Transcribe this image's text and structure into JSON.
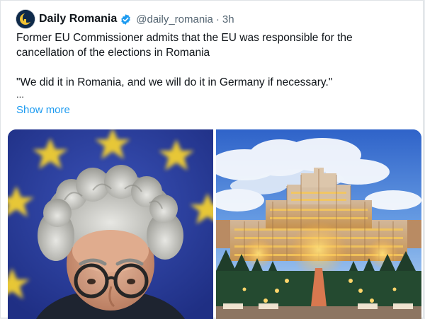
{
  "tweet": {
    "author_name": "Daily Romania",
    "author_handle": "@daily_romania",
    "separator": "·",
    "time_ago": "3h",
    "verified": true,
    "lines": [
      "Former EU Commissioner admits that the EU was responsible for the",
      "cancellation of the elections in Romania",
      "\"We did it in Romania, and we will do it in Germany if necessary.\"",
      "..."
    ],
    "show_more_label": "Show more"
  },
  "colors": {
    "link": "#1d9bf0",
    "verified_badge": "#1d9bf0",
    "text": "#0f1419",
    "muted": "#536471"
  },
  "icons": {
    "verified": "verified-badge-icon",
    "avatar": "daily-romania-logo"
  },
  "media": [
    {
      "kind": "photo",
      "subject": "man with grey hair and round glasses in front of EU flag"
    },
    {
      "kind": "photo",
      "subject": "illuminated Palace of the Parliament at dusk"
    }
  ]
}
